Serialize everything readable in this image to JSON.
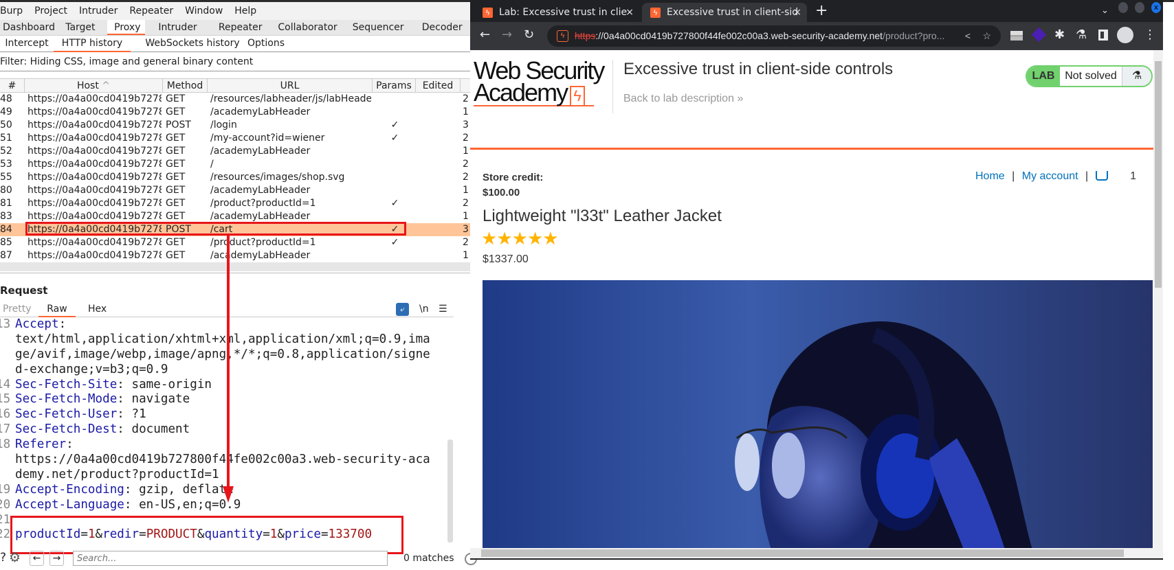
{
  "burp": {
    "menu": [
      "Burp",
      "Project",
      "Intruder",
      "Repeater",
      "Window",
      "Help"
    ],
    "main_tabs": [
      "Dashboard",
      "Target",
      "Proxy",
      "Intruder",
      "Repeater",
      "Collaborator",
      "Sequencer",
      "Decoder"
    ],
    "main_tab_selected": "Proxy",
    "sub_tabs": [
      "Intercept",
      "HTTP history",
      "WebSockets history",
      "Options"
    ],
    "sub_tab_selected": "HTTP history",
    "filter": "Filter: Hiding CSS, image and general binary content",
    "columns": [
      "#",
      "Host",
      "Method",
      "URL",
      "Params",
      "Edited"
    ],
    "sort_icon": "sort-ascending-icon",
    "rows": [
      {
        "id": "48",
        "host": "https://0a4a00cd0419b7278...",
        "method": "GET",
        "url": "/resources/labheader/js/labHeader.js",
        "params": false,
        "extra": "2"
      },
      {
        "id": "49",
        "host": "https://0a4a00cd0419b7278...",
        "method": "GET",
        "url": "/academyLabHeader",
        "params": false,
        "extra": "1"
      },
      {
        "id": "50",
        "host": "https://0a4a00cd0419b7278...",
        "method": "POST",
        "url": "/login",
        "params": true,
        "extra": "3"
      },
      {
        "id": "51",
        "host": "https://0a4a00cd0419b7278...",
        "method": "GET",
        "url": "/my-account?id=wiener",
        "params": true,
        "extra": "2"
      },
      {
        "id": "52",
        "host": "https://0a4a00cd0419b7278...",
        "method": "GET",
        "url": "/academyLabHeader",
        "params": false,
        "extra": "1"
      },
      {
        "id": "53",
        "host": "https://0a4a00cd0419b7278...",
        "method": "GET",
        "url": "/",
        "params": false,
        "extra": "2"
      },
      {
        "id": "55",
        "host": "https://0a4a00cd0419b7278...",
        "method": "GET",
        "url": "/resources/images/shop.svg",
        "params": false,
        "extra": "2"
      },
      {
        "id": "80",
        "host": "https://0a4a00cd0419b7278...",
        "method": "GET",
        "url": "/academyLabHeader",
        "params": false,
        "extra": "1"
      },
      {
        "id": "81",
        "host": "https://0a4a00cd0419b7278...",
        "method": "GET",
        "url": "/product?productId=1",
        "params": true,
        "extra": "2"
      },
      {
        "id": "83",
        "host": "https://0a4a00cd0419b7278...",
        "method": "GET",
        "url": "/academyLabHeader",
        "params": false,
        "extra": "1"
      },
      {
        "id": "84",
        "host": "https://0a4a00cd0419b7278...",
        "method": "POST",
        "url": "/cart",
        "params": true,
        "extra": "3",
        "selected": true
      },
      {
        "id": "85",
        "host": "https://0a4a00cd0419b7278...",
        "method": "GET",
        "url": "/product?productId=1",
        "params": true,
        "extra": "2"
      },
      {
        "id": "87",
        "host": "https://0a4a00cd0419b7278...",
        "method": "GET",
        "url": "/academyLabHeader",
        "params": false,
        "extra": "1"
      }
    ],
    "check_mark": "✓",
    "request": {
      "title": "Request",
      "tabs": [
        "Pretty",
        "Raw",
        "Hex"
      ],
      "tab_selected": "Raw",
      "newline_toggle": "\\n",
      "lines": [
        {
          "n": "13",
          "parts": [
            [
              "k",
              "Accept"
            ],
            [
              "p",
              ":"
            ]
          ]
        },
        {
          "n": "",
          "parts": [
            [
              "p",
              "text/html,application/xhtml+xml,application/xml;q=0.9,ima"
            ]
          ]
        },
        {
          "n": "",
          "parts": [
            [
              "p",
              "ge/avif,image/webp,image/apng,*/*;q=0.8,application/signe"
            ]
          ]
        },
        {
          "n": "",
          "parts": [
            [
              "p",
              "d-exchange;v=b3;q=0.9"
            ]
          ]
        },
        {
          "n": "14",
          "parts": [
            [
              "k",
              "Sec-Fetch-Site"
            ],
            [
              "p",
              ": same-origin"
            ]
          ]
        },
        {
          "n": "15",
          "parts": [
            [
              "k",
              "Sec-Fetch-Mode"
            ],
            [
              "p",
              ": navigate"
            ]
          ]
        },
        {
          "n": "16",
          "parts": [
            [
              "k",
              "Sec-Fetch-User"
            ],
            [
              "p",
              ": ?1"
            ]
          ]
        },
        {
          "n": "17",
          "parts": [
            [
              "k",
              "Sec-Fetch-Dest"
            ],
            [
              "p",
              ": document"
            ]
          ]
        },
        {
          "n": "18",
          "parts": [
            [
              "k",
              "Referer"
            ],
            [
              "p",
              ":"
            ]
          ]
        },
        {
          "n": "",
          "parts": [
            [
              "p",
              "https://0a4a00cd0419b727800f44fe002c00a3.web-security-aca"
            ]
          ]
        },
        {
          "n": "",
          "parts": [
            [
              "p",
              "demy.net/product?productId=1"
            ]
          ]
        },
        {
          "n": "19",
          "parts": [
            [
              "k",
              "Accept-Encoding"
            ],
            [
              "p",
              ": gzip, deflate"
            ]
          ]
        },
        {
          "n": "20",
          "parts": [
            [
              "k",
              "Accept-Language"
            ],
            [
              "p",
              ": en-US,en;q=0.9"
            ]
          ]
        },
        {
          "n": "21",
          "parts": []
        },
        {
          "n": "22",
          "parts": [
            [
              "k",
              "productId"
            ],
            [
              "p",
              "="
            ],
            [
              "v",
              "1"
            ],
            [
              "p",
              "&"
            ],
            [
              "k",
              "redir"
            ],
            [
              "p",
              "="
            ],
            [
              "v",
              "PRODUCT"
            ],
            [
              "p",
              "&"
            ],
            [
              "k",
              "quantity"
            ],
            [
              "p",
              "="
            ],
            [
              "v",
              "1"
            ],
            [
              "p",
              "&"
            ],
            [
              "k",
              "price"
            ],
            [
              "p",
              "="
            ],
            [
              "v",
              "133700"
            ]
          ]
        }
      ],
      "search_placeholder": "Search...",
      "matches": "0 matches"
    }
  },
  "browser": {
    "tabs": [
      {
        "title": "Lab: Excessive trust in client-side controls",
        "visible": "Lab: Excessive trust in clie"
      },
      {
        "title": "Excessive trust in client-side controls",
        "visible": "Excessive trust in client-sid",
        "active": true
      }
    ],
    "url_scheme": "https",
    "url_host": "://0a4a00cd0419b727800f44fe002c00a3.web-security-academy.net",
    "url_path": "/product?pro...",
    "page": {
      "logo_line1": "Web Security",
      "logo_line2": "Academy",
      "lab_title": "Excessive trust in client-side controls",
      "back_link": "Back to lab description",
      "badge_lab": "LAB",
      "badge_status": "Not solved",
      "store_credit_label": "Store credit:",
      "store_credit_value": "$100.00",
      "nav_home": "Home",
      "nav_separator": "|",
      "nav_account": "My account",
      "cart_count": "1",
      "product_name": "Lightweight \"l33t\" Leather Jacket",
      "rating": 5,
      "rating_max": 5,
      "price": "$1337.00"
    }
  },
  "colors": {
    "accent": "#ff6633",
    "selected_row": "#ffc599",
    "annotation": "#e8151b",
    "header_key": "#1a1aa6",
    "value": "#a31515",
    "badge_green": "#70d16d",
    "link": "#0071bc",
    "star": "#ffb400"
  }
}
